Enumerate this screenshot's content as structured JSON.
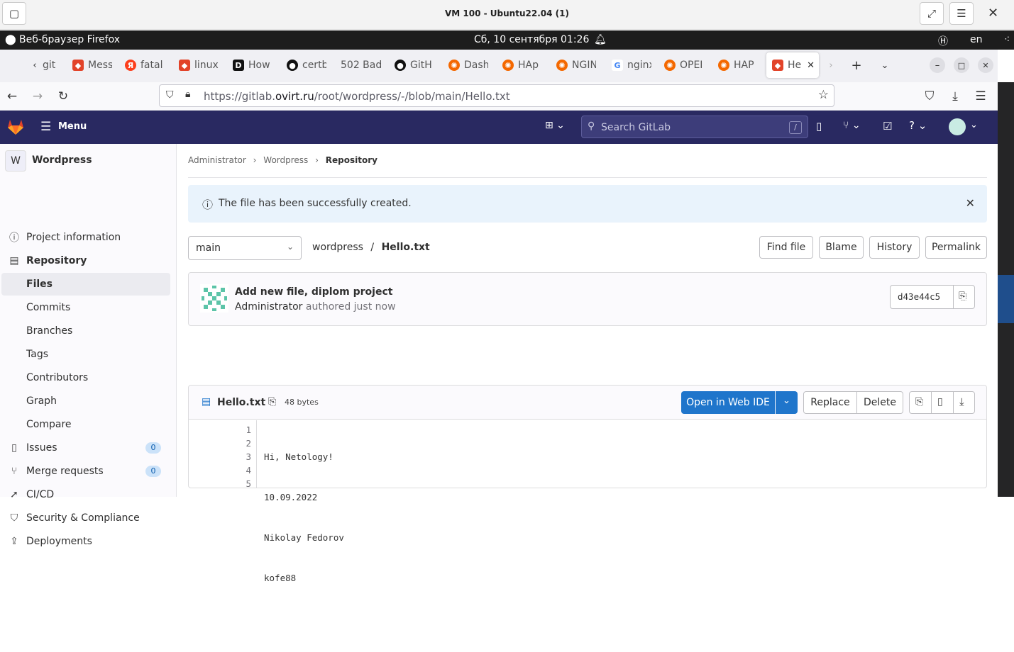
{
  "vm": {
    "title": "VM 100 - Ubuntu22.04 (1)"
  },
  "ubuntu": {
    "app": "Веб-браузер Firefox",
    "clock": "Сб, 10 сентября  01:26",
    "lang": "en"
  },
  "tabs": [
    {
      "label": "git",
      "icon": "gitlab-icon",
      "color": "#e24329"
    },
    {
      "label": "Mess",
      "icon": "gitlab-icon",
      "color": "#e24329"
    },
    {
      "label": "fatal",
      "icon": "yandex-icon",
      "color": "#fc3f1d"
    },
    {
      "label": "linux",
      "icon": "gitlab-icon",
      "color": "#e24329"
    },
    {
      "label": "How",
      "icon": "dev-icon",
      "color": "#111111"
    },
    {
      "label": "certb",
      "icon": "github-icon",
      "color": "#111111"
    },
    {
      "label": "502 Bad",
      "icon": "",
      "color": ""
    },
    {
      "label": "GitH",
      "icon": "github-icon",
      "color": "#111111"
    },
    {
      "label": "Dash",
      "icon": "grafana-icon",
      "color": "#f46800"
    },
    {
      "label": "HAp",
      "icon": "grafana-icon",
      "color": "#f46800"
    },
    {
      "label": "NGIN",
      "icon": "grafana-icon",
      "color": "#f46800"
    },
    {
      "label": "nginx",
      "icon": "google-icon",
      "color": "#4285f4"
    },
    {
      "label": "OPEI",
      "icon": "grafana-icon",
      "color": "#f46800"
    },
    {
      "label": "HAP",
      "icon": "grafana-icon",
      "color": "#f46800"
    },
    {
      "label": "He",
      "icon": "gitlab-icon",
      "color": "#e24329"
    }
  ],
  "browser": {
    "url_prefix": "https://gitlab.",
    "url_domain": "ovirt.ru",
    "url_path": "/root/wordpress/-/blob/main/Hello.txt"
  },
  "gitlab": {
    "menu_label": "Menu",
    "search_placeholder": "Search GitLab",
    "search_shortcut": "/"
  },
  "sidebar": {
    "project_initial": "W",
    "project_name": "Wordpress",
    "items": [
      {
        "label": "Project information",
        "icon": "info-icon"
      },
      {
        "label": "Repository",
        "icon": "repository-icon"
      },
      {
        "label": "Files"
      },
      {
        "label": "Commits"
      },
      {
        "label": "Branches"
      },
      {
        "label": "Tags"
      },
      {
        "label": "Contributors"
      },
      {
        "label": "Graph"
      },
      {
        "label": "Compare"
      },
      {
        "label": "Issues",
        "icon": "issues-icon",
        "badge": "0"
      },
      {
        "label": "Merge requests",
        "icon": "merge-request-icon",
        "badge": "0"
      },
      {
        "label": "CI/CD",
        "icon": "rocket-icon"
      },
      {
        "label": "Security & Compliance",
        "icon": "shield-icon"
      },
      {
        "label": "Deployments",
        "icon": "deploy-icon"
      }
    ]
  },
  "breadcrumb": [
    "Administrator",
    "Wordpress",
    "Repository"
  ],
  "alert": {
    "text": "The file has been successfully created."
  },
  "file_nav": {
    "branch": "main",
    "path_root": "wordpress",
    "path_sep": "/",
    "file": "Hello.txt",
    "buttons": [
      "Find file",
      "Blame",
      "History",
      "Permalink"
    ]
  },
  "commit": {
    "title": "Add new file, diplom project",
    "author": "Administrator",
    "when": "authored just now",
    "sha": "d43e44c5"
  },
  "blob": {
    "name": "Hello.txt",
    "size": "48 bytes",
    "open_ide": "Open in Web IDE",
    "replace": "Replace",
    "delete": "Delete",
    "lines": [
      {
        "n": "1",
        "text": "Hi, Netology!"
      },
      {
        "n": "2",
        "text": "10.09.2022"
      },
      {
        "n": "3",
        "text": "Nikolay Fedorov"
      },
      {
        "n": "4",
        "text": "kofe88"
      },
      {
        "n": "5",
        "text": ""
      }
    ]
  }
}
